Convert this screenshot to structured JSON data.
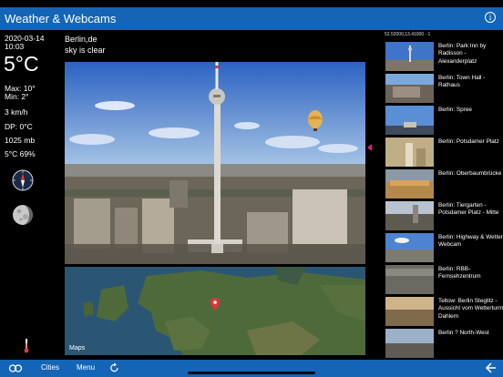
{
  "header": {
    "title": "Weather & Webcams",
    "info_glyph": "i"
  },
  "weather": {
    "date": "2020-03-14",
    "time": "10:03",
    "temperature": "5°C",
    "max": "Max: 10°",
    "min": "Min: 2°",
    "wind": "3 km/h",
    "dew_point": "DP: 0°C",
    "pressure": "1025 mb",
    "humidity": "5°C 69%"
  },
  "location": {
    "city": "Berlin,de",
    "condition": "sky is clear",
    "coords": "52.52000,13.41000 - 1"
  },
  "map": {
    "brand": "Maps"
  },
  "webcams": [
    {
      "label": "Berlin: Park Inn by Radisson - Alexanderplatz"
    },
    {
      "label": "Berlin: Town Hall - Rathaus"
    },
    {
      "label": "Berlin: Spree"
    },
    {
      "label": "Berlin: Potsdamer Platz"
    },
    {
      "label": "Berlin: Oberbaumbrücke"
    },
    {
      "label": "Berlin: Tiergarten - Potsdamer Platz - Mitte"
    },
    {
      "label": "Berlin: Highway & Wetter Webcam"
    },
    {
      "label": "Berlin: RBB-Fernsehzentrum"
    },
    {
      "label": "Teltow: Berlin Steglitz - Aussicht vom Wetterturm Dahlem"
    },
    {
      "label": "Berlin ? North-West"
    }
  ],
  "bottombar": {
    "cities_label": "Cities",
    "menu_label": "Menu"
  },
  "colors": {
    "bar": "#1565b6",
    "marker": "#e0207a",
    "pin": "#e0343a"
  }
}
